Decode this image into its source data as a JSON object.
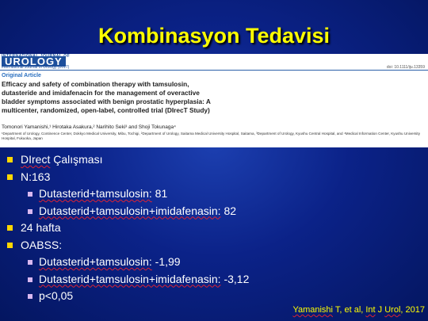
{
  "slide": {
    "title": "Kombinasyon Tedavisi"
  },
  "article": {
    "journal_intl": "INTERNATIONAL JOURNAL OF",
    "journal_name": "UROLOGY",
    "journal_citation": "International Journal of Urology (2017)",
    "doi": "doi: 10.1111/iju.13359",
    "article_type": "Original Article",
    "title_lines": [
      "Efficacy and safety of combination therapy with tamsulosin,",
      "dutasteride and imidafenacin for the management of overactive",
      "bladder symptoms associated with benign prostatic hyperplasia: A",
      "multicenter, randomized, open-label, controlled trial (DIrecT Study)"
    ],
    "authors": "Tomonori Yamanishi,¹ Hirotaka Asakura,² Narihito Seki³ and Shoji Tokunaga⁴",
    "affiliations": "¹Department of Urology, Continence Center, Dokkyo Medical University, Mibu, Tochigi, ²Department of Urology, Saitama Medical University Hospital, Saitama, ³Department of Urology, Kyushu Central Hospital, and ⁴Medical Information Center, Kyushu University Hospital, Fukuoka, Japan"
  },
  "bullets": [
    {
      "level": 1,
      "text": "DIrect Çalışması",
      "underline": "DIrect"
    },
    {
      "level": 1,
      "text": "N:163"
    },
    {
      "level": 2,
      "text": "Dutasterid+tamsulosin: 81",
      "underline": "Dutasterid+tamsulosin:"
    },
    {
      "level": 2,
      "text": "Dutasterid+tamsulosin+imidafenasin: 82",
      "underline": "Dutasterid+tamsulosin+imidafenasin:"
    },
    {
      "level": 1,
      "text": "24 hafta"
    },
    {
      "level": 1,
      "text": "OABSS:"
    },
    {
      "level": 2,
      "text": "Dutasterid+tamsulosin: -1,99",
      "underline": "Dutasterid+tamsulosin:"
    },
    {
      "level": 2,
      "text": "Dutasterid+tamsulosin+imidafenasin: -3,12",
      "underline": "Dutasterid+tamsulosin+imidafenasin:"
    },
    {
      "level": 2,
      "text": "p<0,05"
    }
  ],
  "citation": "Yamanishi T, et al, Int J Urol, 2017",
  "colors": {
    "title": "#ffff00",
    "bullet_l1": "#ffd700",
    "bullet_l2": "#d9b8f0",
    "background": "#0b2288"
  }
}
